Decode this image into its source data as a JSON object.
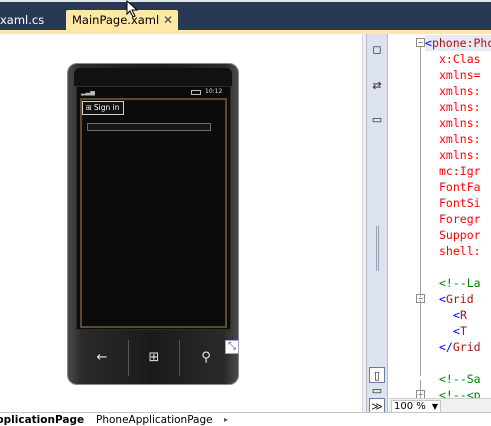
{
  "tabs": [
    {
      "label": "xaml.cs",
      "active": false
    },
    {
      "label": "MainPage.xaml",
      "active": true
    }
  ],
  "tab_close_glyph": "✕",
  "designer": {
    "status_bar": {
      "signal": "▂▃▅",
      "time": "10:12"
    },
    "signin_button": {
      "icon": "windows-logo-icon",
      "label": "Sign in"
    },
    "hardware_buttons": [
      {
        "name": "back",
        "glyph": "←"
      },
      {
        "name": "start",
        "glyph": "⊞"
      },
      {
        "name": "search",
        "glyph": "⚲"
      }
    ],
    "resize_glyph": "⤡"
  },
  "splitter": {
    "buttons_top": [
      "◻",
      "⇄",
      "▭"
    ],
    "buttons_bottom": [
      "▯",
      "▭",
      "≫"
    ]
  },
  "code": {
    "fold_glyph": "−",
    "lines": [
      {
        "indent": 0,
        "parts": [
          {
            "t": "<",
            "c": "blue"
          },
          {
            "t": "phone",
            "c": "brown"
          },
          {
            "t": ":Pho",
            "c": "brown"
          }
        ],
        "fold": true,
        "highlight": true
      },
      {
        "indent": 2,
        "parts": [
          {
            "t": "x:Clas",
            "c": "red"
          }
        ]
      },
      {
        "indent": 2,
        "parts": [
          {
            "t": "xmlns=",
            "c": "red"
          }
        ]
      },
      {
        "indent": 2,
        "parts": [
          {
            "t": "xmlns:",
            "c": "red"
          }
        ]
      },
      {
        "indent": 2,
        "parts": [
          {
            "t": "xmlns:",
            "c": "red"
          }
        ]
      },
      {
        "indent": 2,
        "parts": [
          {
            "t": "xmlns:",
            "c": "red"
          }
        ]
      },
      {
        "indent": 2,
        "parts": [
          {
            "t": "xmlns:",
            "c": "red"
          }
        ]
      },
      {
        "indent": 2,
        "parts": [
          {
            "t": "xmlns:",
            "c": "red"
          }
        ]
      },
      {
        "indent": 2,
        "parts": [
          {
            "t": "mc:Igr",
            "c": "red"
          }
        ]
      },
      {
        "indent": 2,
        "parts": [
          {
            "t": "FontFa",
            "c": "red"
          }
        ]
      },
      {
        "indent": 2,
        "parts": [
          {
            "t": "FontSi",
            "c": "red"
          }
        ]
      },
      {
        "indent": 2,
        "parts": [
          {
            "t": "Foregr",
            "c": "red"
          }
        ]
      },
      {
        "indent": 2,
        "parts": [
          {
            "t": "Suppor",
            "c": "red"
          }
        ]
      },
      {
        "indent": 2,
        "parts": [
          {
            "t": "shell:",
            "c": "red"
          }
        ]
      },
      {
        "indent": 0,
        "parts": [
          {
            "t": "",
            "c": "blue"
          }
        ]
      },
      {
        "indent": 2,
        "parts": [
          {
            "t": "<!--La",
            "c": "green"
          }
        ]
      },
      {
        "indent": 2,
        "parts": [
          {
            "t": "<",
            "c": "blue"
          },
          {
            "t": "Grid",
            "c": "brown"
          },
          {
            "t": " ",
            "c": "red"
          }
        ],
        "fold": true
      },
      {
        "indent": 4,
        "parts": [
          {
            "t": "<",
            "c": "blue"
          },
          {
            "t": "R",
            "c": "brown"
          }
        ]
      },
      {
        "indent": 4,
        "parts": [
          {
            "t": "<",
            "c": "blue"
          },
          {
            "t": "T",
            "c": "brown"
          }
        ]
      },
      {
        "indent": 2,
        "parts": [
          {
            "t": "</",
            "c": "blue"
          },
          {
            "t": "Grid",
            "c": "brown"
          }
        ]
      },
      {
        "indent": 0,
        "parts": [
          {
            "t": "",
            "c": "blue"
          }
        ]
      },
      {
        "indent": 2,
        "parts": [
          {
            "t": "<!--Sa",
            "c": "green"
          }
        ]
      },
      {
        "indent": 2,
        "parts": [
          {
            "t": "<!--<p",
            "c": "green"
          }
        ],
        "fold": true
      }
    ]
  },
  "zoom": {
    "value": "100 %",
    "arrow": "▼"
  },
  "breadcrumb": [
    {
      "label": "ApplicationPage"
    },
    {
      "label": "PhoneApplicationPage"
    }
  ],
  "breadcrumb_sep": "▸"
}
